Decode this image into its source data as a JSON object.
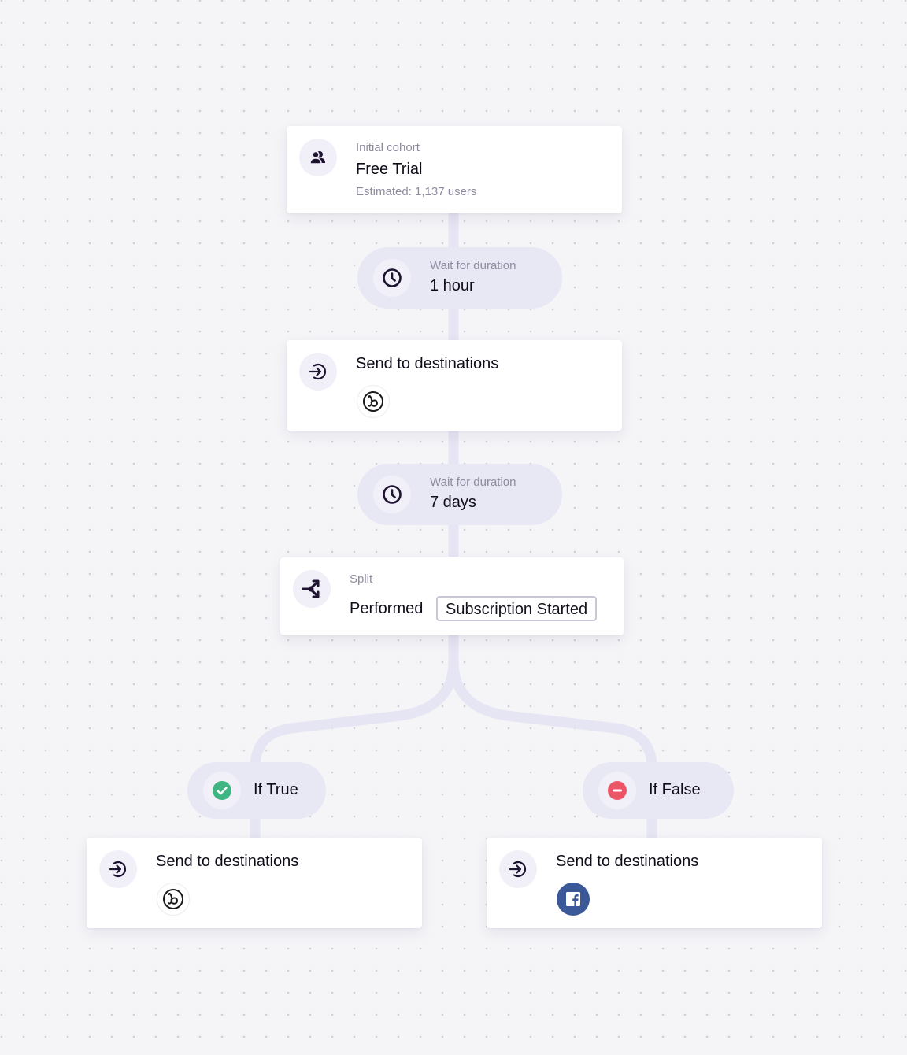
{
  "colors": {
    "background": "#f5f5f8",
    "connector": "#e6e5f3",
    "pill": "#e8e7f4",
    "icon_bg": "#f1f0f8",
    "icon_fg": "#1e1331",
    "muted_text": "#8e8ba0",
    "true_green": "#3fb583",
    "false_red": "#ec5567",
    "facebook_blue": "#3b5998"
  },
  "flow": {
    "cohort": {
      "label": "Initial cohort",
      "title": "Free Trial",
      "estimate": "Estimated: 1,137 users",
      "icon": "users-icon"
    },
    "wait1": {
      "label": "Wait for duration",
      "value": "1 hour",
      "icon": "clock-icon"
    },
    "send1": {
      "title": "Send to destinations",
      "icon": "send-arrow-icon",
      "destinations": [
        "braze-logo"
      ]
    },
    "wait2": {
      "label": "Wait for duration",
      "value": "7 days",
      "icon": "clock-icon"
    },
    "split": {
      "label": "Split",
      "condition": "Performed",
      "event": "Subscription Started",
      "icon": "split-icon"
    },
    "branch_true": {
      "label": "If True",
      "icon": "check-circle-icon",
      "send": {
        "title": "Send to destinations",
        "destinations": [
          "braze-logo"
        ]
      }
    },
    "branch_false": {
      "label": "If False",
      "icon": "minus-circle-icon",
      "send": {
        "title": "Send to destinations",
        "destinations": [
          "facebook-logo"
        ]
      }
    }
  }
}
